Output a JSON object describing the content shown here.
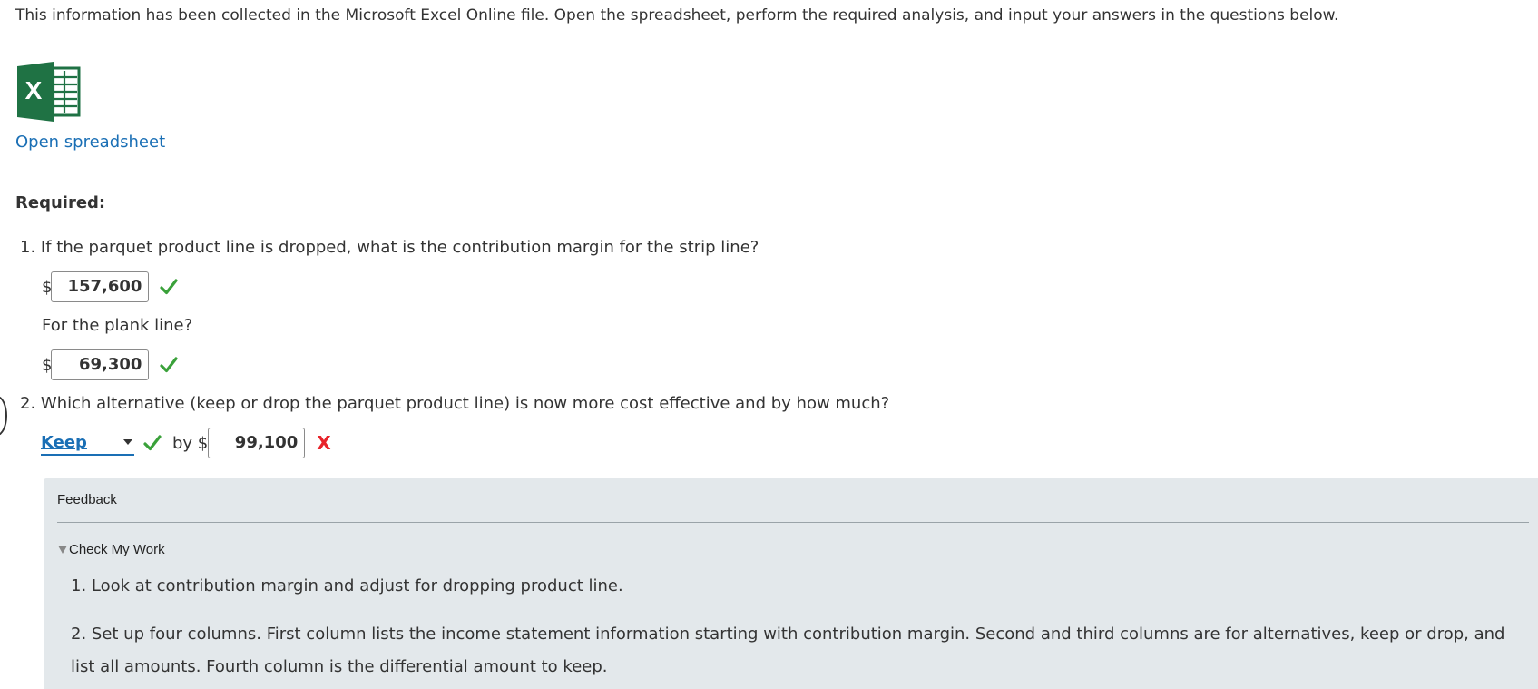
{
  "intro_text": "This information has been collected in the Microsoft Excel Online file. Open the spreadsheet, perform the required analysis, and input your answers in the questions below.",
  "excel_icon": {
    "letter": "X",
    "name": "excel-icon",
    "color": "#1f7244"
  },
  "open_spreadsheet_label": "Open spreadsheet",
  "required_label": "Required:",
  "questions": {
    "q1_text": "1. If the parquet product line is dropped, what is the contribution margin for the strip line?",
    "q1_currency": "$",
    "q1_answer": "157,600",
    "q1_status": "correct",
    "q1b_text": "For the plank line?",
    "q1b_currency": "$",
    "q1b_answer": "69,300",
    "q1b_status": "correct",
    "q2_text": "2. Which alternative (keep or drop the parquet product line) is now more cost effective and by how much?",
    "q2_select_value": "Keep",
    "q2_select_status": "correct",
    "q2_by_label": "by $",
    "q2_answer": "99,100",
    "q2_status": "incorrect",
    "incorrect_mark": "X"
  },
  "feedback": {
    "title": "Feedback",
    "toggle_label": "Check My Work",
    "line1": "1. Look at contribution margin and adjust for dropping product line.",
    "line2a": "2. Set up four columns. First column lists the income statement information starting with contribution margin. Second and third columns are for alternatives, keep or drop, and",
    "line2b": "list all amounts. Fourth column is the differential amount to keep."
  },
  "colors": {
    "link": "#1a6fb5",
    "correct": "#3aa13a",
    "incorrect": "#e8232a",
    "feedback_bg": "#e3e8eb"
  }
}
